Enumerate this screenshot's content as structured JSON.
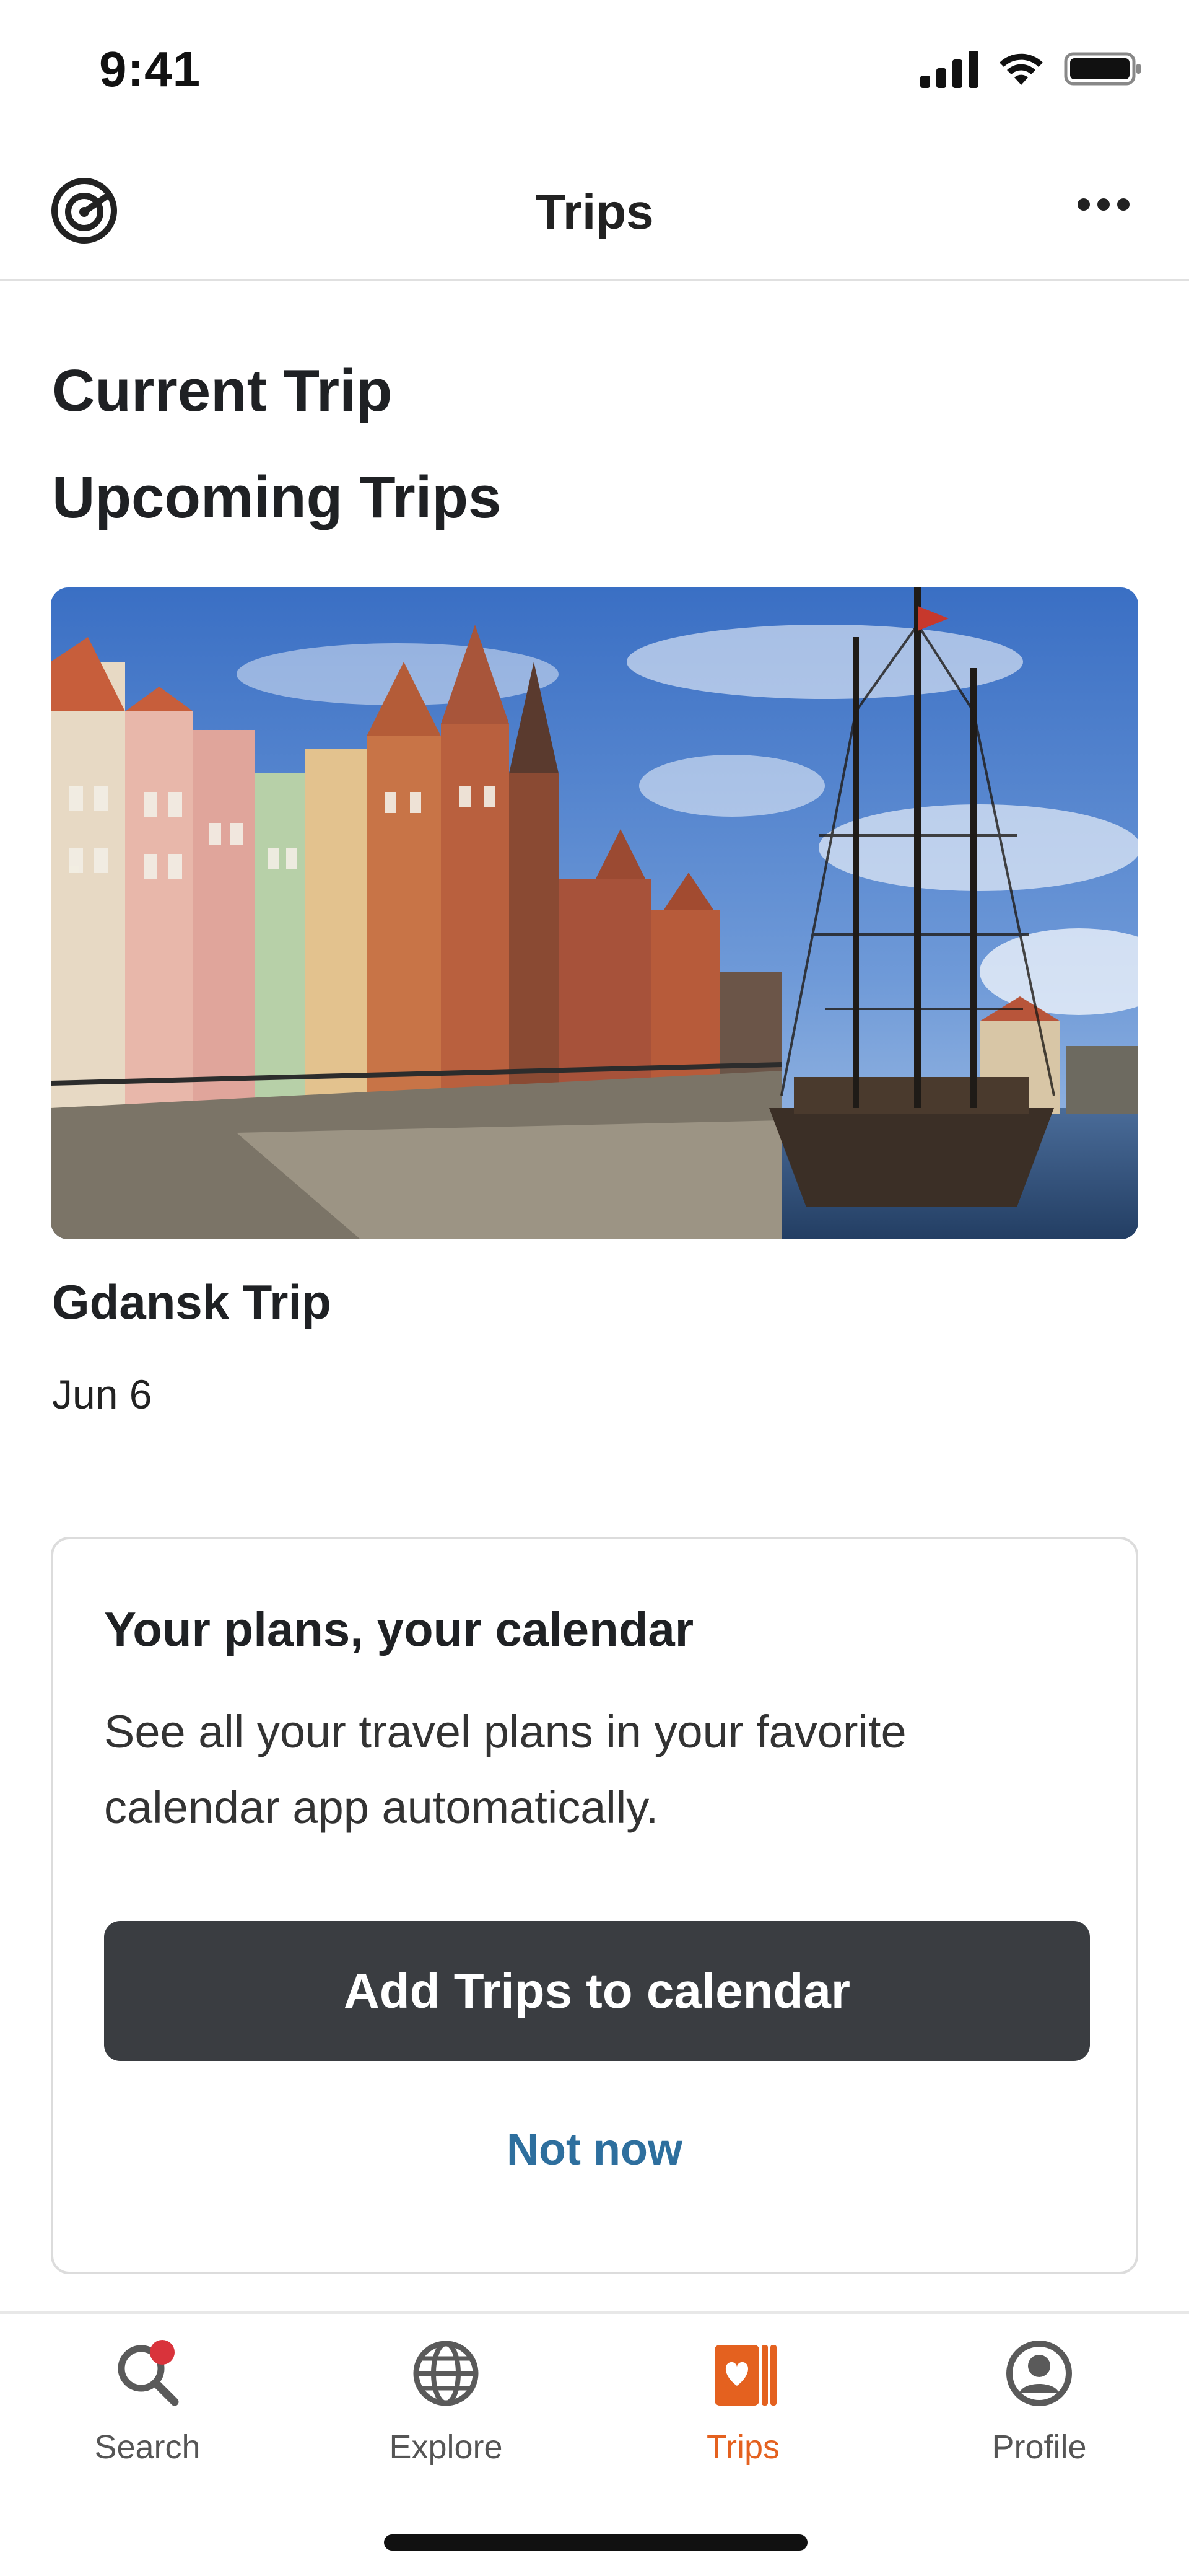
{
  "status_bar": {
    "time": "9:41",
    "icons": [
      "signal-icon",
      "wifi-icon",
      "battery-icon"
    ]
  },
  "header": {
    "title": "Trips",
    "logo_icon": "app-logo-icon",
    "more_icon": "more-options-icon"
  },
  "sections": {
    "current_trip": "Current Trip",
    "upcoming_trips": "Upcoming Trips"
  },
  "upcoming": [
    {
      "name": "Gdansk Trip",
      "date": "Jun 6",
      "image_icon": "gdansk-waterfront-photo"
    }
  ],
  "calendar_prompt": {
    "title": "Your plans, your calendar",
    "body": "See all your travel plans in your favorite calendar app automatically.",
    "primary_button": "Add Trips to calendar",
    "secondary_button": "Not now"
  },
  "tab_bar": {
    "items": [
      {
        "label": "Search",
        "icon": "search-icon",
        "active": false
      },
      {
        "label": "Explore",
        "icon": "globe-icon",
        "active": false
      },
      {
        "label": "Trips",
        "icon": "trips-icon",
        "active": true
      },
      {
        "label": "Profile",
        "icon": "profile-icon",
        "active": false
      }
    ]
  },
  "colors": {
    "accent": "#e4611f",
    "link": "#2e6f9e",
    "button_dark": "#3a3d41",
    "notification_dot": "#d9333b"
  }
}
